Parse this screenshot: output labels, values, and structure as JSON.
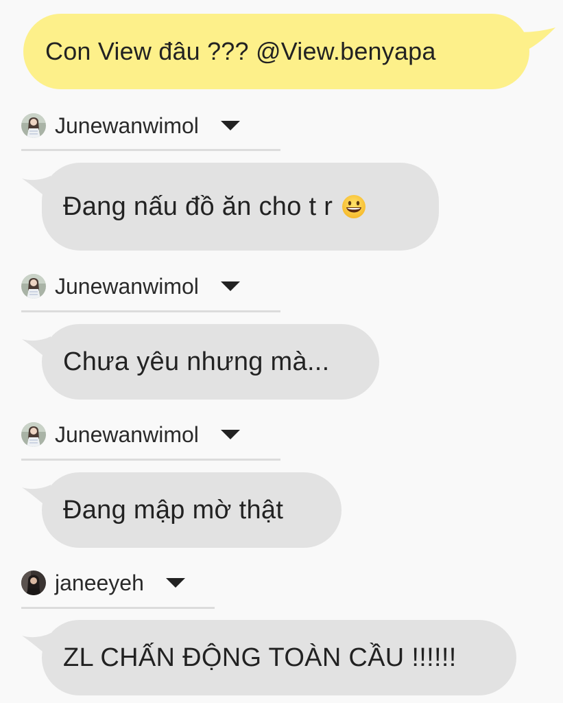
{
  "messages": [
    {
      "type": "outgoing",
      "text": "Con View đâu ??? @View.benyapa"
    },
    {
      "type": "incoming",
      "sender": "Junewanwimol",
      "avatar_icon": "girl-avatar-outdoor",
      "text": "Đang nấu đồ ăn cho t r",
      "emoji": "grinning-face-icon"
    },
    {
      "type": "incoming",
      "sender": "Junewanwimol",
      "avatar_icon": "girl-avatar-outdoor",
      "text": "Chưa yêu nhưng mà..."
    },
    {
      "type": "incoming",
      "sender": "Junewanwimol",
      "avatar_icon": "girl-avatar-outdoor",
      "text": "Đang mập mờ thật"
    },
    {
      "type": "incoming",
      "sender": "janeeyeh",
      "avatar_icon": "girl-avatar-dark",
      "text": "ZL CHẤN ĐỘNG TOÀN CẦU !!!!!!"
    }
  ],
  "colors": {
    "outgoing_bubble": "#fdf08a",
    "incoming_bubble": "#e2e2e2",
    "background": "#f9f9f9",
    "divider": "#dcdcdc"
  }
}
